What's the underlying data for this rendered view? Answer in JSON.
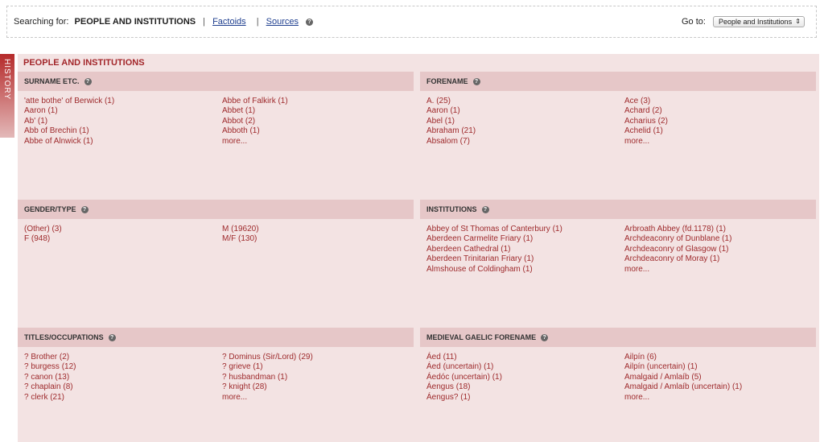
{
  "topbar": {
    "searching_label": "Searching for:",
    "current": "PEOPLE AND INSTITUTIONS",
    "links": [
      "Factoids",
      "Sources"
    ],
    "goto_label": "Go to:",
    "goto_value": "People and Institutions"
  },
  "history_tab": "HISTORY",
  "panel_title": "PEOPLE AND INSTITUTIONS",
  "sections": [
    {
      "title": "SURNAME ETC.",
      "col1": [
        "'atte bothe' of Berwick (1)",
        "Aaron (1)",
        "Ab' (1)",
        "Abb of Brechin (1)",
        "Abbe of Alnwick (1)"
      ],
      "col2": [
        "Abbe of Falkirk (1)",
        "Abbet (1)",
        "Abbot (2)",
        "Abboth (1)",
        "more..."
      ]
    },
    {
      "title": "FORENAME",
      "col1": [
        "A. (25)",
        "Aaron (1)",
        "Abel (1)",
        "Abraham (21)",
        "Absalom (7)"
      ],
      "col2": [
        "Ace (3)",
        "Achard (2)",
        "Acharius (2)",
        "Achelid (1)",
        "more..."
      ]
    },
    {
      "title": "GENDER/TYPE",
      "col1": [
        "(Other) (3)",
        "F (948)"
      ],
      "col2": [
        "M (19620)",
        "M/F (130)"
      ]
    },
    {
      "title": "INSTITUTIONS",
      "col1": [
        "Abbey of St Thomas of Canterbury (1)",
        "Aberdeen Carmelite Friary (1)",
        "Aberdeen Cathedral (1)",
        "Aberdeen Trinitarian Friary (1)",
        "Almshouse of Coldingham (1)"
      ],
      "col2": [
        "Arbroath Abbey (fd.1178) (1)",
        "Archdeaconry of Dunblane (1)",
        "Archdeaconry of Glasgow (1)",
        "Archdeaconry of Moray (1)",
        "more..."
      ]
    },
    {
      "title": "TITLES/OCCUPATIONS",
      "col1": [
        "? Brother (2)",
        "? burgess (12)",
        "? canon (13)",
        "? chaplain (8)",
        "? clerk (21)"
      ],
      "col2": [
        "? Dominus (Sir/Lord) (29)",
        "? grieve (1)",
        "? husbandman (1)",
        "? knight (28)",
        "more..."
      ]
    },
    {
      "title": "MEDIEVAL GAELIC FORENAME",
      "col1": [
        "Áed (11)",
        "Áed (uncertain) (1)",
        "Áedóc (uncertain) (1)",
        "Áengus (18)",
        "Áengus? (1)"
      ],
      "col2": [
        "Ailpín (6)",
        "Ailpín (uncertain) (1)",
        "Amalgaid / Amlaíb (5)",
        "Amalgaid / Amlaíb (uncertain) (1)",
        "more..."
      ]
    }
  ]
}
